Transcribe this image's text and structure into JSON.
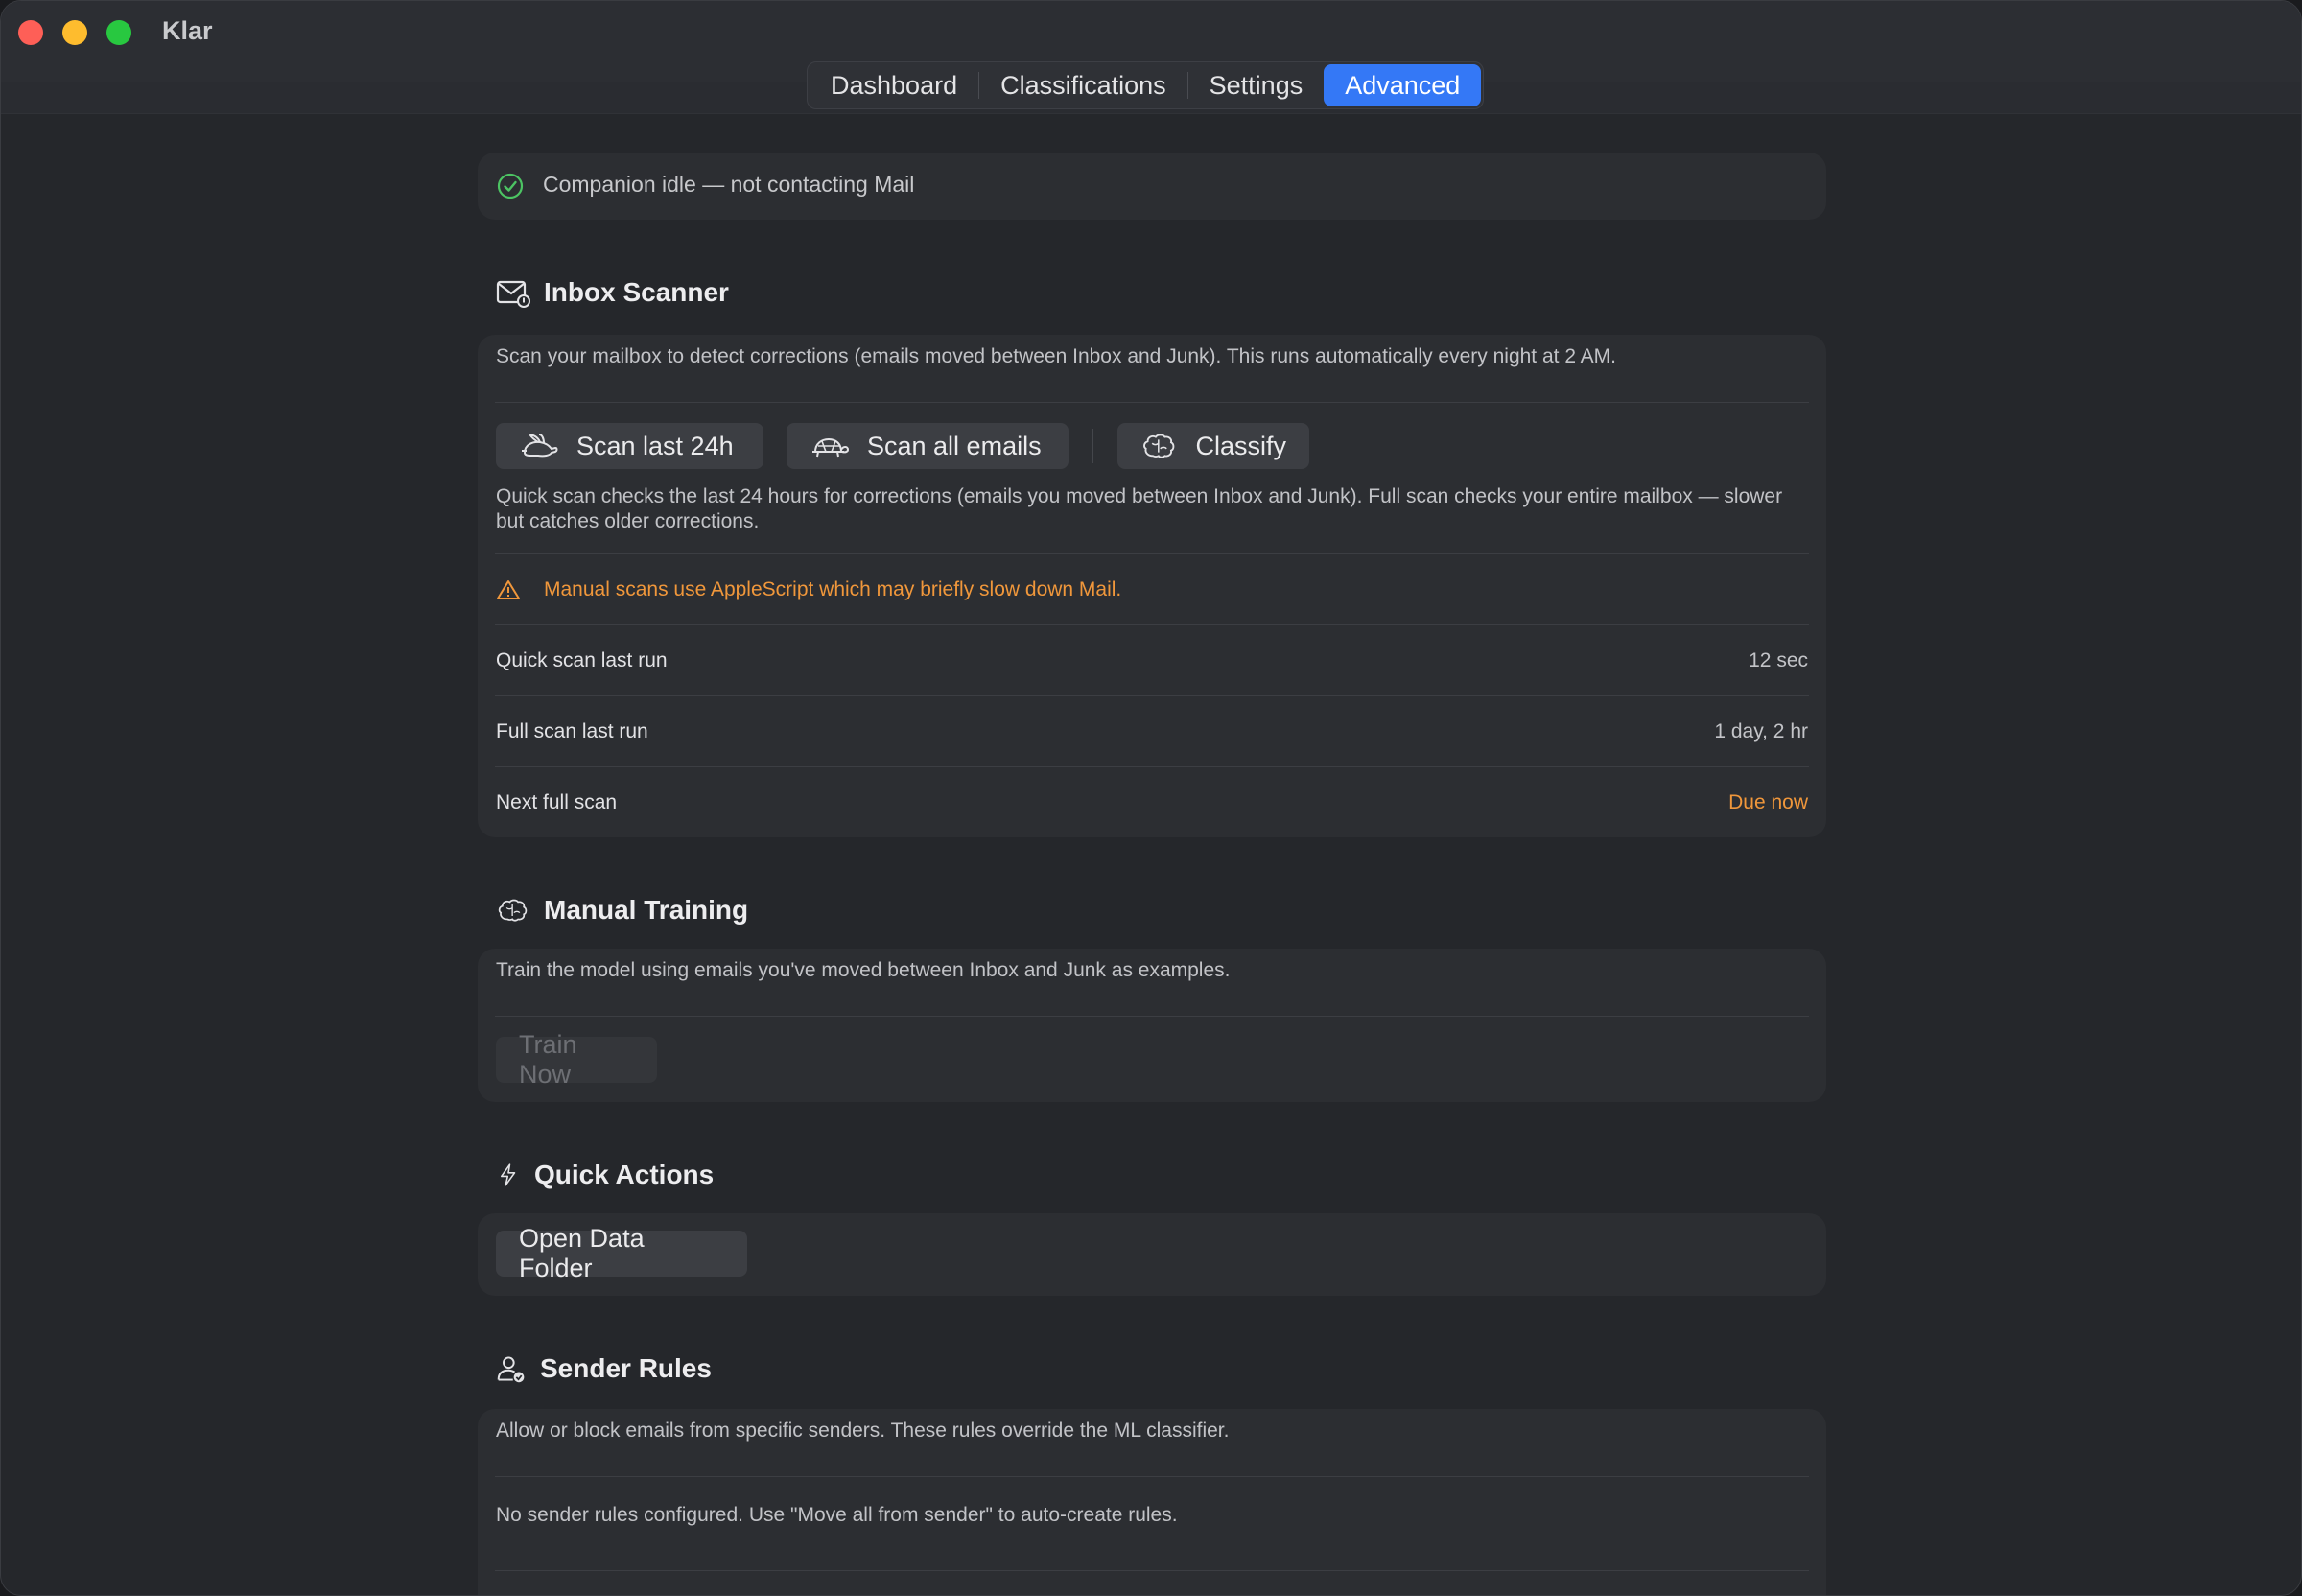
{
  "window": {
    "title": "Klar"
  },
  "tabs": [
    {
      "label": "Dashboard",
      "active": false
    },
    {
      "label": "Classifications",
      "active": false
    },
    {
      "label": "Settings",
      "active": false
    },
    {
      "label": "Advanced",
      "active": true
    }
  ],
  "status": {
    "text": "Companion idle — not contacting Mail",
    "icon": "check-circle-icon",
    "color": "#4cc463"
  },
  "inbox_scanner": {
    "title": "Inbox Scanner",
    "icon": "mail-badge-icon",
    "description": "Scan your mailbox to detect corrections (emails moved between Inbox and Junk). This runs automatically every night at 2 AM.",
    "buttons": {
      "scan_24h": {
        "label": "Scan last 24h",
        "icon": "hare-icon"
      },
      "scan_all": {
        "label": "Scan all emails",
        "icon": "tortoise-icon"
      },
      "classify": {
        "label": "Classify",
        "icon": "brain-icon"
      }
    },
    "scan_help": "Quick scan checks the last 24 hours for corrections (emails you moved between Inbox and Junk). Full scan checks your entire mailbox — slower but catches older corrections.",
    "warning": {
      "text": "Manual scans use AppleScript which may briefly slow down Mail.",
      "icon": "warning-triangle-icon",
      "color": "#f0973b"
    },
    "stats": [
      {
        "label": "Quick scan last run",
        "value": "12 sec",
        "highlight": false
      },
      {
        "label": "Full scan last run",
        "value": "1 day, 2 hr",
        "highlight": false
      },
      {
        "label": "Next full scan",
        "value": "Due now",
        "highlight": true
      }
    ]
  },
  "manual_training": {
    "title": "Manual Training",
    "icon": "brain-icon",
    "description": "Train the model using emails you've moved between Inbox and Junk as examples.",
    "button": {
      "label": "Train Now",
      "enabled": false
    }
  },
  "quick_actions": {
    "title": "Quick Actions",
    "icon": "bolt-icon",
    "button": {
      "label": "Open Data Folder"
    }
  },
  "sender_rules": {
    "title": "Sender Rules",
    "icon": "person-check-icon",
    "description": "Allow or block emails from specific senders. These rules override the ML classifier.",
    "empty_text": "No sender rules configured. Use \"Move all from sender\" to auto-create rules."
  },
  "colors": {
    "accent": "#3478f6",
    "warning": "#f0973b",
    "success": "#4cc463"
  }
}
